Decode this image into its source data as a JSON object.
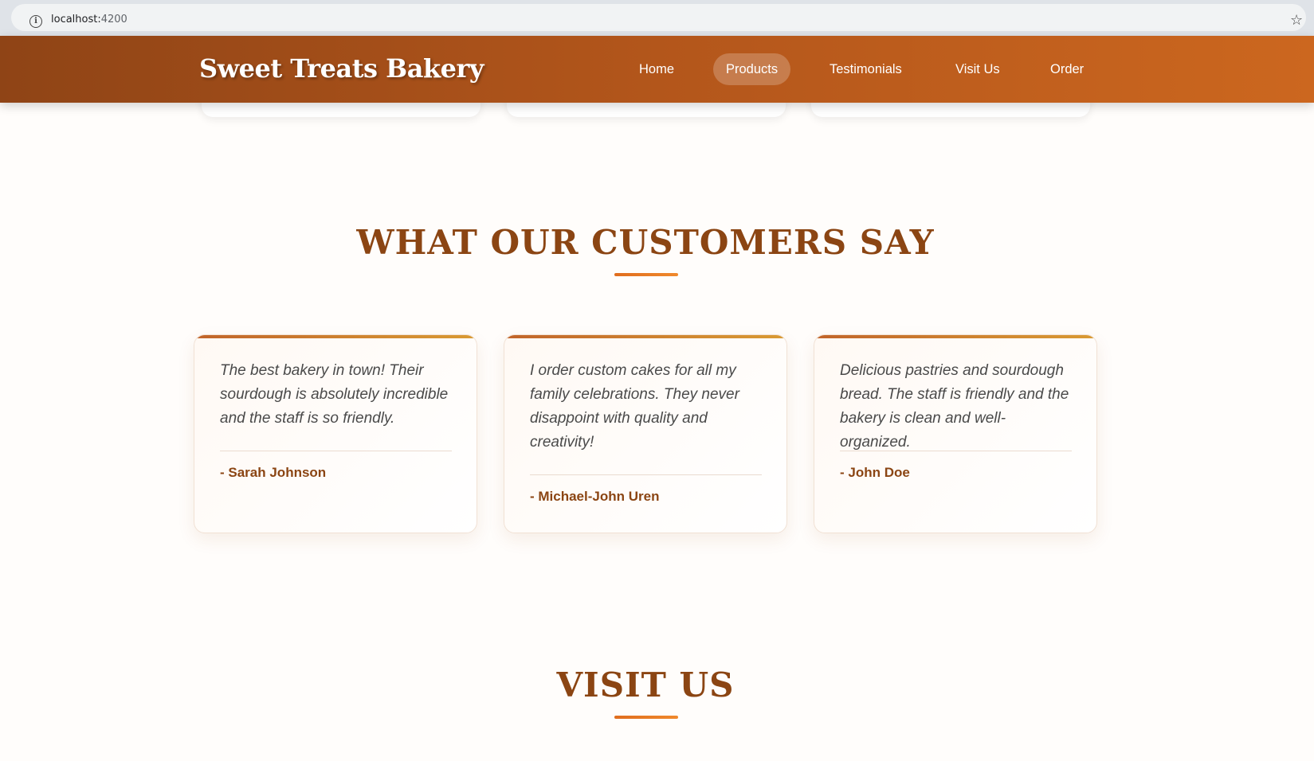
{
  "browser": {
    "url_host": "localhost:",
    "url_port": "4200"
  },
  "header": {
    "logo": "Sweet Treats Bakery",
    "nav": [
      {
        "label": "Home",
        "active": false
      },
      {
        "label": "Products",
        "active": true
      },
      {
        "label": "Testimonials",
        "active": false
      },
      {
        "label": "Visit Us",
        "active": false
      },
      {
        "label": "Order",
        "active": false
      }
    ]
  },
  "testimonials": {
    "title": "WHAT OUR CUSTOMERS SAY",
    "items": [
      {
        "quote": "The best bakery in town! Their sourdough is absolutely incredible and the staff is so friendly.",
        "author": "- Sarah Johnson"
      },
      {
        "quote": "I order custom cakes for all my family celebrations. They never disappoint with quality and creativity!",
        "author": "- Michael-John Uren"
      },
      {
        "quote": "Delicious pastries and sourdough bread. The staff is friendly and the bakery is clean and well-organized.",
        "author": "- John Doe"
      }
    ]
  },
  "visit": {
    "title": "VISIT US"
  },
  "colors": {
    "brand_brown": "#8b4513",
    "header_start": "#8f4416",
    "header_end": "#cc671f",
    "accent_orange": "#e06d1e"
  }
}
